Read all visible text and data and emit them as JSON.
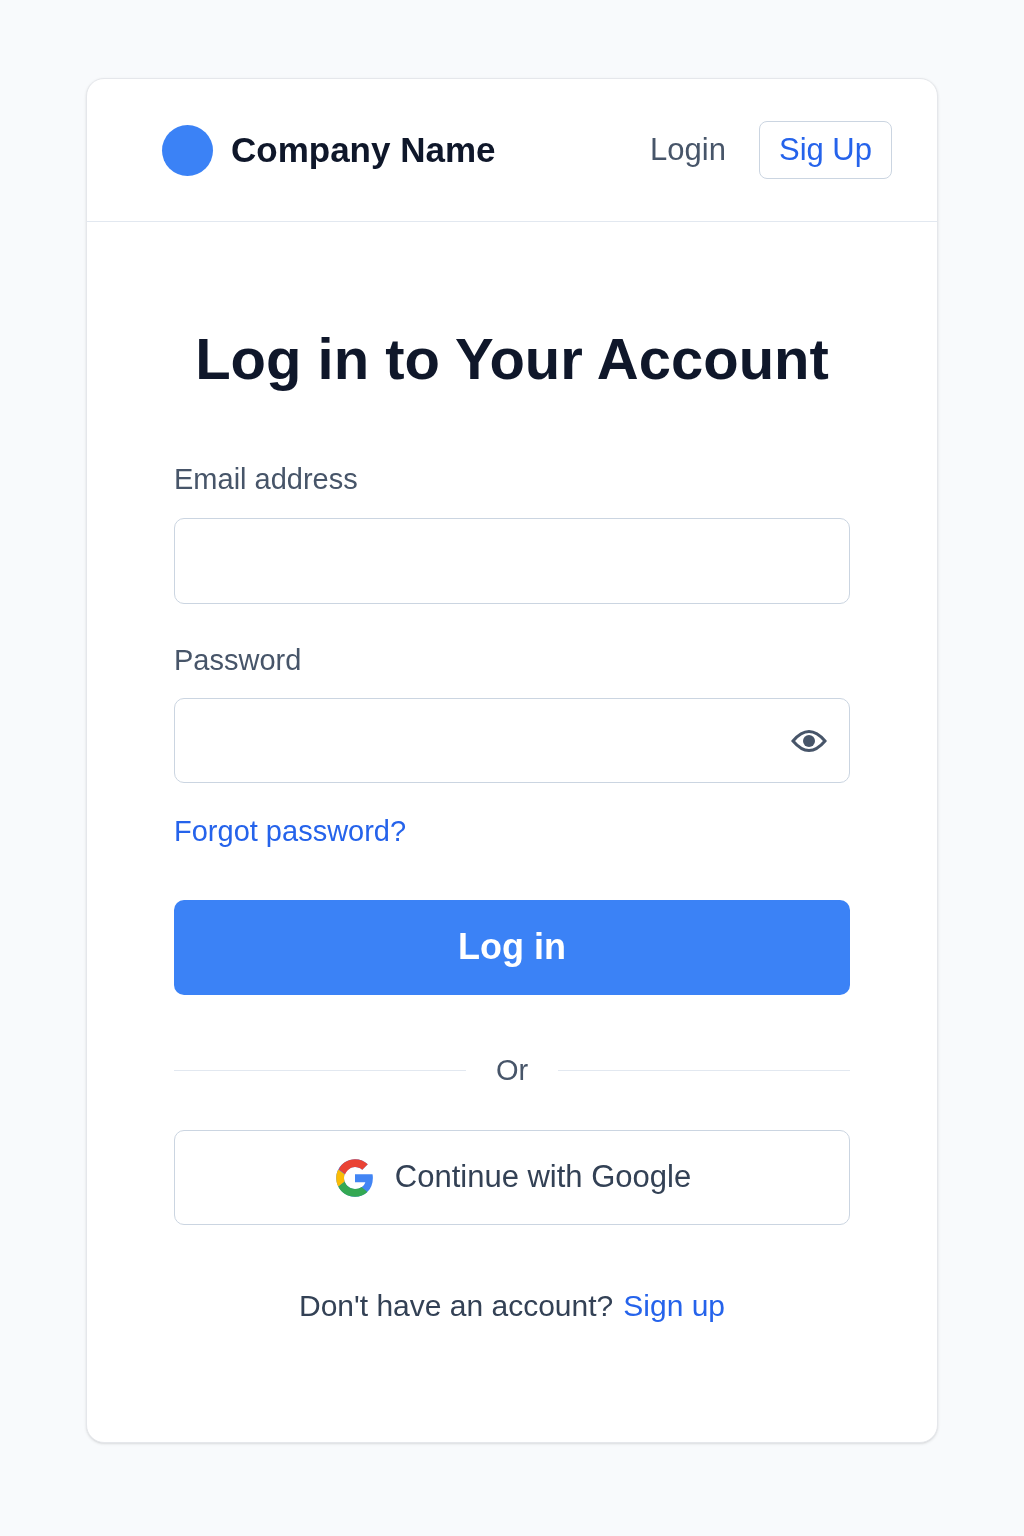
{
  "header": {
    "company_name": "Company Name",
    "login_link": "Login",
    "signup_button": "Sig Up"
  },
  "title": "Log in to Your Account",
  "email": {
    "label": "Email address"
  },
  "password": {
    "label": "Password"
  },
  "forgot_link": "Forgot password?",
  "login_button": "Log in",
  "divider": "Or",
  "google_button": "Continue with Google",
  "signup_prompt": {
    "text": "Don't have an account?",
    "link": "Sign up"
  }
}
